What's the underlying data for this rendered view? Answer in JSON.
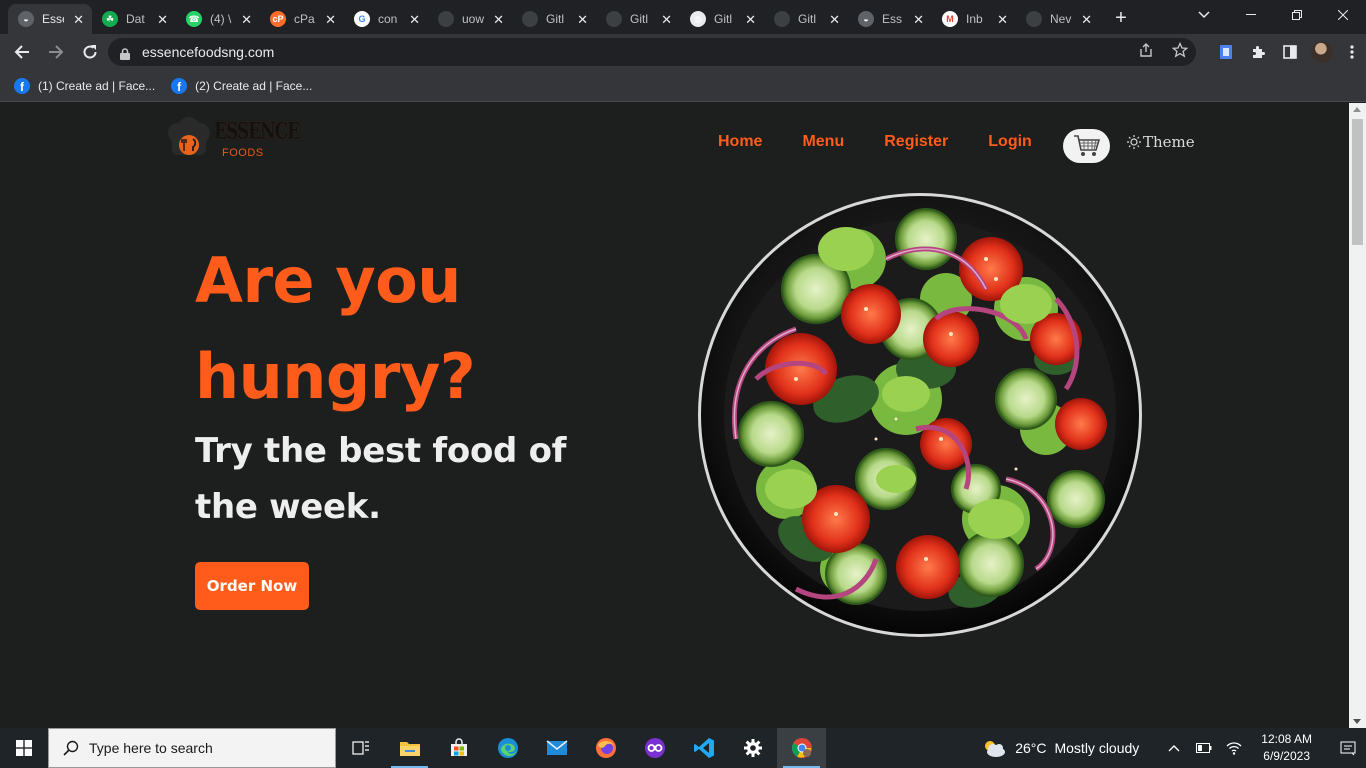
{
  "browser": {
    "tabs": [
      {
        "title": "Esse",
        "favicon": "essence-favicon",
        "active": true
      },
      {
        "title": "Dat",
        "favicon": "mongodb-leaf-icon"
      },
      {
        "title": "(4) \\",
        "favicon": "whatsapp-icon"
      },
      {
        "title": "cPa",
        "favicon": "cpanel-icon"
      },
      {
        "title": "con",
        "favicon": "google-icon"
      },
      {
        "title": "uow",
        "favicon": "github-icon"
      },
      {
        "title": "Gitl",
        "favicon": "github-icon"
      },
      {
        "title": "Gitl",
        "favicon": "github-icon"
      },
      {
        "title": "Gitl",
        "favicon": "globe-icon"
      },
      {
        "title": "Gitl",
        "favicon": "github-icon"
      },
      {
        "title": "Ess",
        "favicon": "essence-favicon"
      },
      {
        "title": "Inb",
        "favicon": "gmail-icon"
      },
      {
        "title": "Nev",
        "favicon": "new-tab-icon"
      }
    ],
    "url": "essencefoodsng.com",
    "bookmarks": [
      {
        "label": "(1) Create ad | Face..."
      },
      {
        "label": "(2) Create ad | Face..."
      }
    ]
  },
  "site": {
    "logo_word1": "ESSENCE",
    "logo_word2": "FOODS",
    "nav": [
      "Home",
      "Menu",
      "Register",
      "Login"
    ],
    "theme_label": "Theme",
    "hero_line1": "Are you",
    "hero_line2": "hungry?",
    "hero_sub": "Try the best food of the week.",
    "cta": "Order Now",
    "accent_color": "#ff5c1c",
    "background_color": "#1c1f1d"
  },
  "taskbar": {
    "search_placeholder": "Type here to search",
    "pinned": [
      "task-view-icon",
      "file-explorer-icon",
      "microsoft-store-icon",
      "edge-icon",
      "mail-icon",
      "firefox-icon",
      "app-icon",
      "vscode-icon",
      "settings-icon",
      "chrome-icon"
    ],
    "weather_temp": "26°C",
    "weather_desc": "Mostly cloudy",
    "time": "12:08 AM",
    "date": "6/9/2023"
  }
}
